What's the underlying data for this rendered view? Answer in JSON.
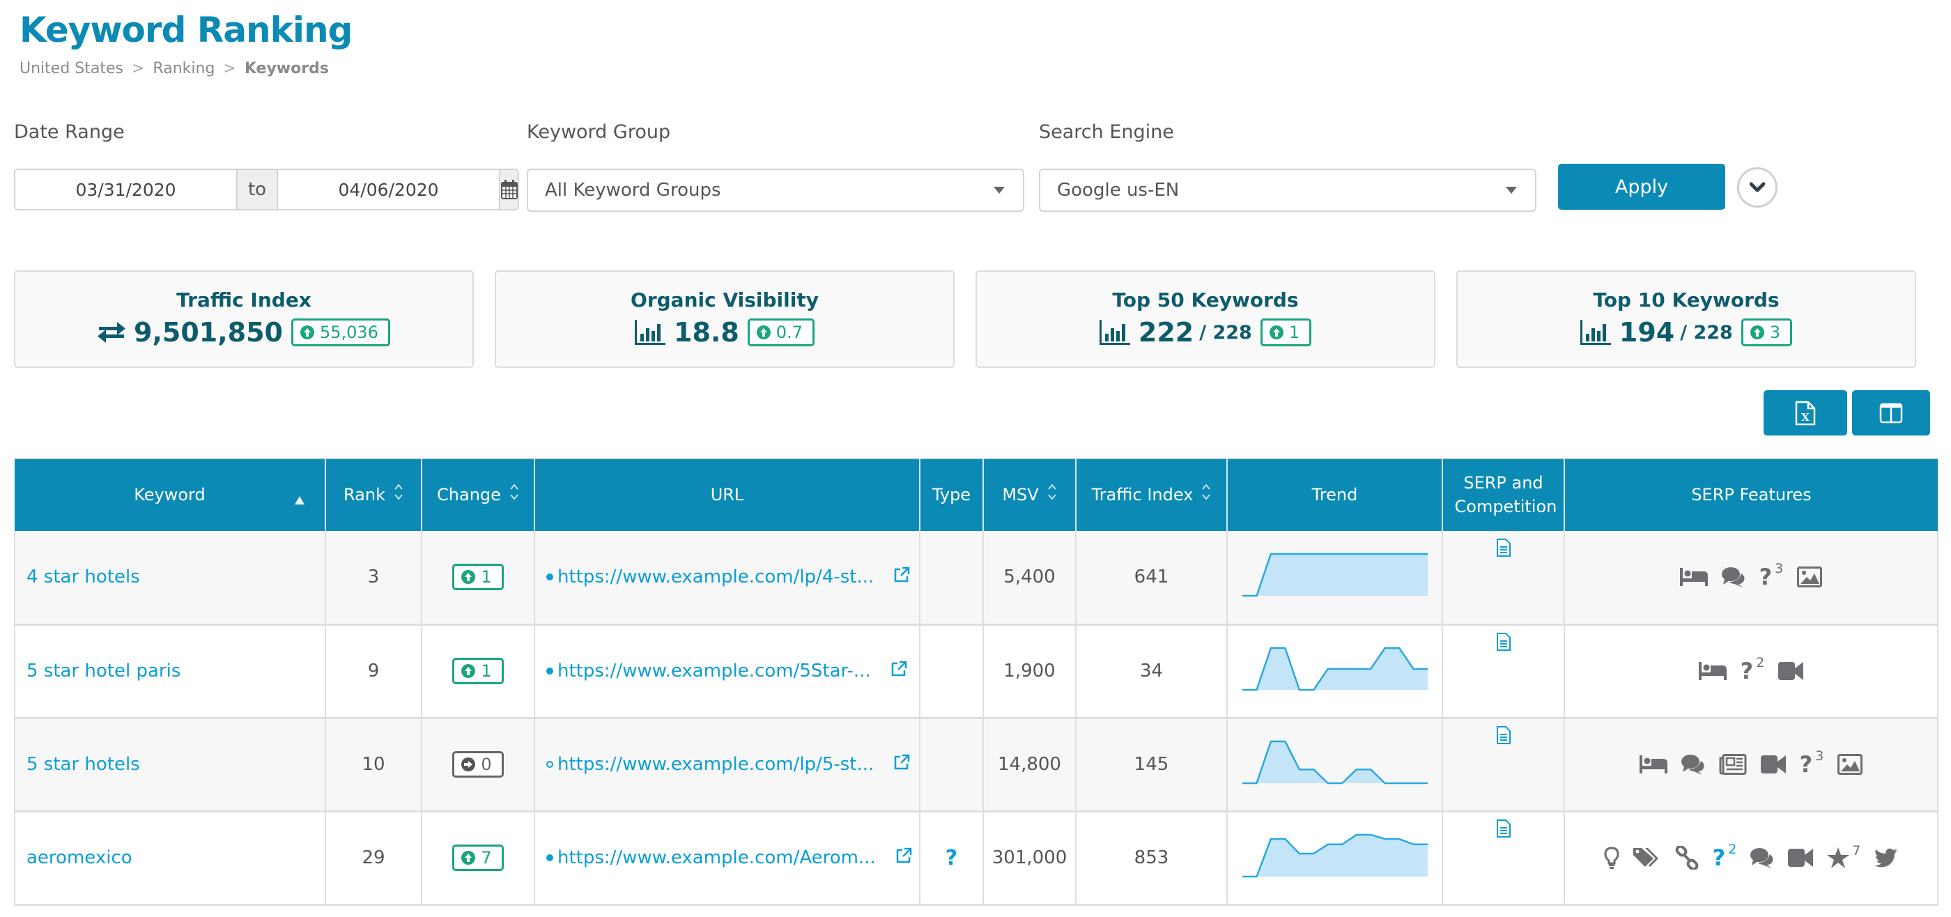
{
  "header": {
    "title": "Keyword Ranking",
    "breadcrumb": [
      "United States",
      "Ranking",
      "Keywords"
    ],
    "breadcrumb_separator": ">"
  },
  "filters": {
    "date_range_label": "Date Range",
    "date_from": "03/31/2020",
    "date_to_label": "to",
    "date_to": "04/06/2020",
    "keyword_group_label": "Keyword Group",
    "keyword_group_value": "All Keyword Groups",
    "search_engine_label": "Search Engine",
    "search_engine_value": "Google us-EN",
    "apply_label": "Apply"
  },
  "kpis": [
    {
      "title": "Traffic Index",
      "icon": "exchange-arrows-icon",
      "value": "9,501,850",
      "total": "",
      "delta": "55,036",
      "direction": "up"
    },
    {
      "title": "Organic Visibility",
      "icon": "bar-chart-icon",
      "value": "18.8",
      "total": "",
      "delta": "0.7",
      "direction": "up"
    },
    {
      "title": "Top 50 Keywords",
      "icon": "bar-chart-icon",
      "value": "222",
      "total": "/ 228",
      "delta": "1",
      "direction": "up"
    },
    {
      "title": "Top 10 Keywords",
      "icon": "bar-chart-icon",
      "value": "194",
      "total": "/ 228",
      "delta": "3",
      "direction": "up"
    }
  ],
  "toolbar": {
    "export_icon": "excel-export-icon",
    "columns_icon": "columns-toggle-icon"
  },
  "table": {
    "columns": [
      {
        "label": "Keyword",
        "sort": "asc"
      },
      {
        "label": "Rank",
        "sort": "both"
      },
      {
        "label": "Change",
        "sort": "both"
      },
      {
        "label": "URL",
        "sort": "none"
      },
      {
        "label": "Type",
        "sort": "none"
      },
      {
        "label": "MSV",
        "sort": "both"
      },
      {
        "label": "Traffic Index",
        "sort": "both"
      },
      {
        "label": "Trend",
        "sort": "none"
      },
      {
        "label": "SERP and Competition",
        "sort": "none"
      },
      {
        "label": "SERP Features",
        "sort": "none"
      }
    ],
    "rows": [
      {
        "keyword": "4 star hotels",
        "rank": "3",
        "change": "1",
        "change_dir": "up",
        "url": "https://www.example.com/lp/4-st...",
        "url_marker": "filled",
        "type": "",
        "msv": "5,400",
        "traffic_index": "641",
        "trend": [
          0,
          0,
          1,
          1,
          1,
          1,
          1,
          1,
          1,
          1,
          1,
          1,
          1,
          1
        ],
        "features": [
          {
            "icon": "hotel-bed-icon",
            "count": ""
          },
          {
            "icon": "comments-icon",
            "count": ""
          },
          {
            "icon": "question-icon",
            "count": "3"
          },
          {
            "icon": "image-icon",
            "count": ""
          }
        ]
      },
      {
        "keyword": "5 star hotel paris",
        "rank": "9",
        "change": "1",
        "change_dir": "up",
        "url": "https://www.example.com/5Star-...",
        "url_marker": "filled",
        "type": "",
        "msv": "1,900",
        "traffic_index": "34",
        "trend": [
          0,
          0,
          1,
          1,
          0,
          0,
          0.5,
          0.5,
          0.5,
          0.5,
          1,
          1,
          0.5,
          0.5
        ],
        "features": [
          {
            "icon": "hotel-bed-icon",
            "count": ""
          },
          {
            "icon": "question-icon",
            "count": "2"
          },
          {
            "icon": "video-icon",
            "count": ""
          }
        ]
      },
      {
        "keyword": "5 star hotels",
        "rank": "10",
        "change": "0",
        "change_dir": "none",
        "url": "https://www.example.com/lp/5-st...",
        "url_marker": "hollow",
        "type": "",
        "msv": "14,800",
        "traffic_index": "145",
        "trend": [
          0,
          0,
          1,
          1,
          0.33,
          0.33,
          0,
          0,
          0.33,
          0.33,
          0,
          0,
          0,
          0
        ],
        "features": [
          {
            "icon": "hotel-bed-icon",
            "count": ""
          },
          {
            "icon": "comments-icon",
            "count": ""
          },
          {
            "icon": "news-icon",
            "count": ""
          },
          {
            "icon": "video-icon",
            "count": ""
          },
          {
            "icon": "question-icon",
            "count": "3"
          },
          {
            "icon": "image-icon",
            "count": ""
          }
        ]
      },
      {
        "keyword": "aeromexico",
        "rank": "29",
        "change": "7",
        "change_dir": "up",
        "url": "https://www.example.com/Aerom...",
        "url_marker": "filled",
        "type": "question",
        "msv": "301,000",
        "traffic_index": "853",
        "trend": [
          0,
          0,
          0.9,
          0.9,
          0.55,
          0.55,
          0.77,
          0.77,
          1,
          1,
          0.9,
          0.9,
          0.77,
          0.77
        ],
        "features": [
          {
            "icon": "lightbulb-icon",
            "count": ""
          },
          {
            "icon": "tags-icon",
            "count": ""
          },
          {
            "icon": "link-icon",
            "count": ""
          },
          {
            "icon": "question-icon",
            "count": "2",
            "highlight": true
          },
          {
            "icon": "comments-icon",
            "count": ""
          },
          {
            "icon": "video-icon",
            "count": ""
          },
          {
            "icon": "star-icon",
            "count": "7"
          },
          {
            "icon": "twitter-icon",
            "count": ""
          }
        ]
      }
    ]
  },
  "colors": {
    "brand": "#0a8ab5",
    "link": "#0a9ed6",
    "kpi_text": "#0d5c6d",
    "positive": "#1aa57e",
    "neutral": "#666666",
    "icon_gray": "#6d6e71",
    "sparkline_fill": "#c3e5f7",
    "sparkline_line": "#2aa8e0"
  }
}
